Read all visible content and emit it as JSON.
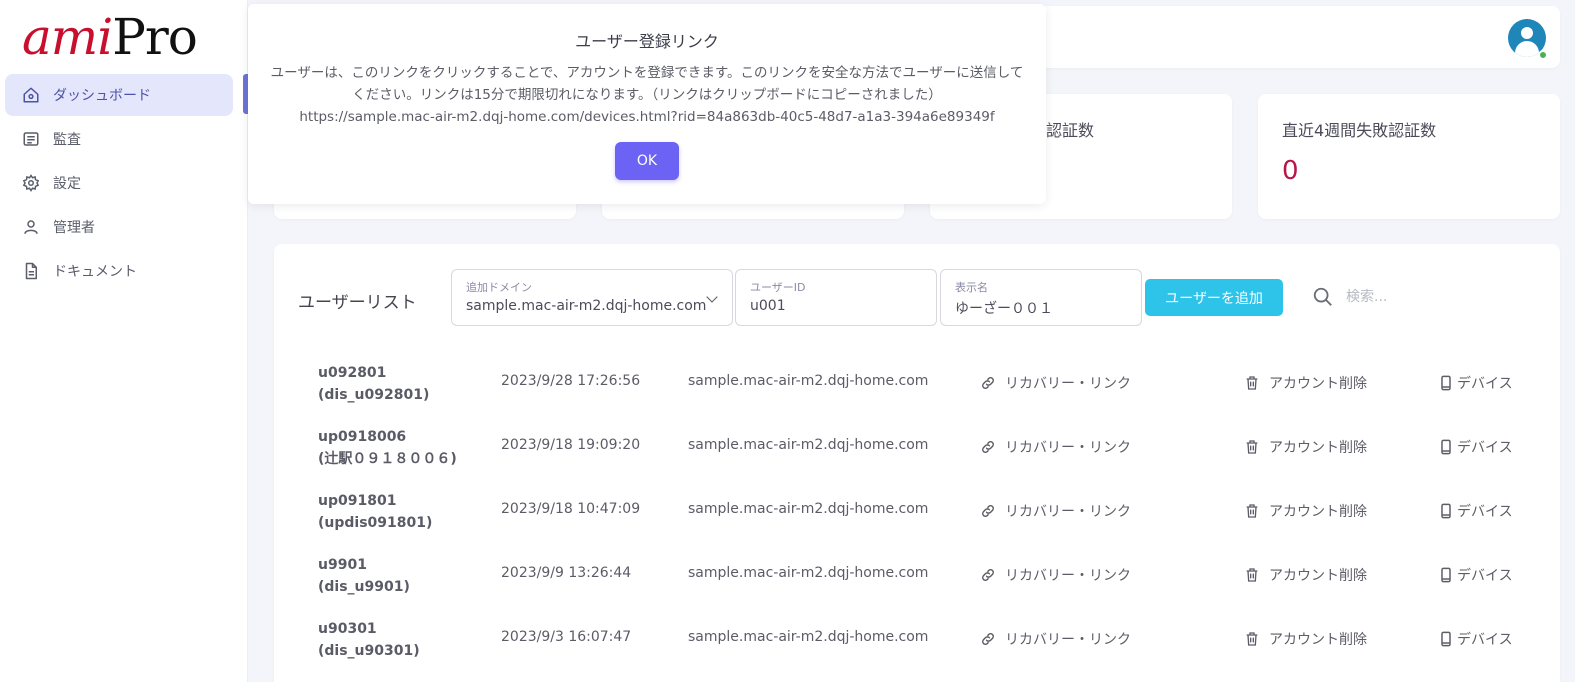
{
  "logo": {
    "ami": "ami",
    "pro": "Pro"
  },
  "sidebar": {
    "items": [
      {
        "label": "ダッシュボード",
        "icon": "home-icon"
      },
      {
        "label": "監査",
        "icon": "list-icon"
      },
      {
        "label": "設定",
        "icon": "gear-icon"
      },
      {
        "label": "管理者",
        "icon": "user-icon"
      },
      {
        "label": "ドキュメント",
        "icon": "document-icon"
      }
    ]
  },
  "cards": [
    {
      "label": "",
      "value": ""
    },
    {
      "label": "",
      "value": ""
    },
    {
      "label": "認証数",
      "value": ""
    },
    {
      "label": "直近4週間失敗認証数",
      "value": "0"
    }
  ],
  "dialog": {
    "title": "ユーザー登録リンク",
    "message": "ユーザーは、このリンクをクリックすることで、アカウントを登録できます。このリンクを安全な方法でユーザーに送信してください。リンクは15分で期限切れになります。（リンクはクリップボードにコピーされました）",
    "url": "https://sample.mac-air-m2.dqj-home.com/devices.html?rid=84a863db-40c5-48d7-a1a3-394a6e89349f",
    "ok_label": "OK"
  },
  "userlist": {
    "title": "ユーザーリスト",
    "domain_field": {
      "label": "追加ドメイン",
      "value": "sample.mac-air-m2.dqj-home.com"
    },
    "userid_field": {
      "label": "ユーザーID",
      "value": "u001"
    },
    "displayname_field": {
      "label": "表示名",
      "value": "ゆーざー００１"
    },
    "add_label": "ユーザーを追加",
    "search_placeholder": "検索..."
  },
  "actions": {
    "recovery": "リカバリー・リンク",
    "delete": "アカウント削除",
    "device": "デバイス"
  },
  "users": [
    {
      "id": "u092801",
      "display": "(dis_u092801)",
      "date": "2023/9/28 17:26:56",
      "domain": "sample.mac-air-m2.dqj-home.com"
    },
    {
      "id": "up0918006",
      "display": "(辻駅０９１８００６)",
      "date": "2023/9/18 19:09:20",
      "domain": "sample.mac-air-m2.dqj-home.com"
    },
    {
      "id": "up091801",
      "display": "(updis091801)",
      "date": "2023/9/18 10:47:09",
      "domain": "sample.mac-air-m2.dqj-home.com"
    },
    {
      "id": "u9901",
      "display": "(dis_u9901)",
      "date": "2023/9/9 13:26:44",
      "domain": "sample.mac-air-m2.dqj-home.com"
    },
    {
      "id": "u90301",
      "display": "(dis_u90301)",
      "date": "2023/9/3 16:07:47",
      "domain": "sample.mac-air-m2.dqj-home.com"
    }
  ],
  "colors": {
    "accent": "#6c63f5",
    "add_button": "#2ec4ea",
    "danger_value": "#b8164a",
    "nav_active_bg": "#e4e6fb"
  }
}
